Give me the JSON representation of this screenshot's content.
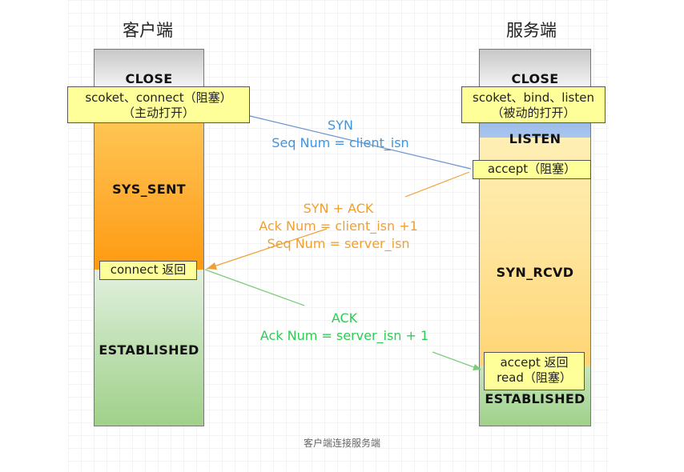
{
  "titles": {
    "client": "客户端",
    "server": "服务端"
  },
  "client": {
    "states": {
      "close": "CLOSE",
      "sys_sent": "SYS_SENT",
      "established": "ESTABLISHED"
    },
    "notes": {
      "connect_line1": "scoket、connect（阻塞）",
      "connect_line2": "（主动打开）",
      "connect_return": "connect 返回"
    }
  },
  "server": {
    "states": {
      "close": "CLOSE",
      "listen": "LISTEN",
      "syn_rcvd": "SYN_RCVD",
      "established": "ESTABLISHED"
    },
    "notes": {
      "bind_line1": "scoket、bind、listen",
      "bind_line2": "（被动的打开）",
      "accept": "accept（阻塞）",
      "accept_return": "accept 返回",
      "read": "read（阻塞）"
    }
  },
  "messages": {
    "syn": {
      "line1": "SYN",
      "line2": "Seq Num = client_isn",
      "color": "#3f95e0"
    },
    "synack": {
      "line1": "SYN + ACK",
      "line2": "Ack Num =  client_isn +1",
      "line3": "Seq Num = server_isn",
      "color": "#f0a030"
    },
    "ack": {
      "line1": "ACK",
      "line2": "Ack Num = server_isn + 1",
      "color": "#2ecc55"
    }
  },
  "caption": "客户端连接服务端"
}
